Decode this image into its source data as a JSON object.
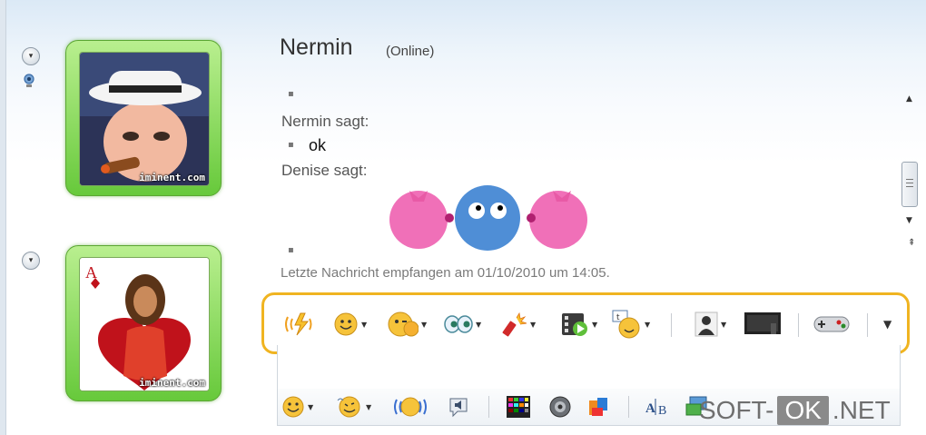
{
  "contact": {
    "name": "Nermin",
    "status": "(Online)"
  },
  "avatars": {
    "brand": "iminent.com"
  },
  "conversation": {
    "line1_sender": "Nermin sagt:",
    "line1_text": "ok",
    "line2_sender": "Denise sagt:",
    "last_message": "Letzte Nachricht empfangen am 01/10/2010 um 14:05."
  },
  "toolbar": {
    "highlight_color": "#f0b421",
    "items": [
      "nudge-icon",
      "emoticon-icon",
      "wink-icon",
      "eyes-icon",
      "firework-icon",
      "video-icon",
      "speech-icon",
      "contact-icon",
      "screen-icon",
      "gamepad-icon",
      "more-icon"
    ]
  },
  "bottom_toolbar": {
    "items": [
      "smiley-icon",
      "dancing-smiley-icon",
      "bouncing-smiley-icon",
      "sound-icon",
      "colors-icon",
      "voice-icon",
      "paint-icon",
      "translate-icon",
      "share-icon"
    ]
  },
  "watermark": {
    "part1": "SOFT-",
    "part2": "OK",
    "part3": ".NET"
  }
}
